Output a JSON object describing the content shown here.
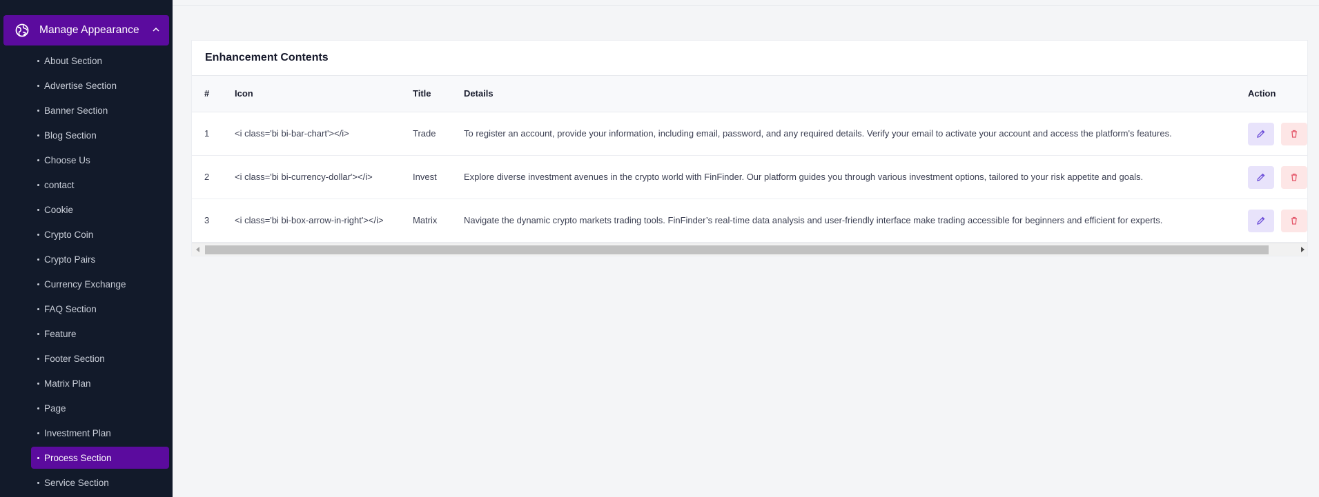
{
  "sidebar": {
    "group": {
      "label": "Manage Appearance",
      "icon": "globe-icon",
      "expanded": true
    },
    "items": [
      {
        "label": "About Section"
      },
      {
        "label": "Advertise Section"
      },
      {
        "label": "Banner Section"
      },
      {
        "label": "Blog Section"
      },
      {
        "label": "Choose Us"
      },
      {
        "label": "contact"
      },
      {
        "label": "Cookie"
      },
      {
        "label": "Crypto Coin"
      },
      {
        "label": "Crypto Pairs"
      },
      {
        "label": "Currency Exchange"
      },
      {
        "label": "FAQ Section"
      },
      {
        "label": "Feature"
      },
      {
        "label": "Footer Section"
      },
      {
        "label": "Matrix Plan"
      },
      {
        "label": "Page"
      },
      {
        "label": "Investment Plan"
      },
      {
        "label": "Process Section",
        "active": true
      },
      {
        "label": "Service Section"
      }
    ]
  },
  "card": {
    "title": "Enhancement Contents"
  },
  "table": {
    "headers": {
      "num": "#",
      "icon": "Icon",
      "title": "Title",
      "details": "Details",
      "action": "Action"
    },
    "rows": [
      {
        "num": "1",
        "icon": "<i class='bi bi-bar-chart'></i>",
        "title": "Trade",
        "details": "To register an account, provide your information, including email, password, and any required details. Verify your email to activate your account and access the platform's features."
      },
      {
        "num": "2",
        "icon": "<i class='bi bi-currency-dollar'></i>",
        "title": "Invest",
        "details": "Explore diverse investment avenues in the crypto world with FinFinder. Our platform guides you through various investment options, tailored to your risk appetite and goals."
      },
      {
        "num": "3",
        "icon": "<i class='bi bi-box-arrow-in-right'></i>",
        "title": "Matrix",
        "details": "Navigate the dynamic crypto markets trading tools. FinFinder’s real-time data analysis and user-friendly interface make trading accessible for beginners and efficient for experts."
      }
    ]
  },
  "colors": {
    "sidebar_bg": "#121a2a",
    "accent": "#5b0b9e",
    "edit_btn": "#e8e3fb",
    "delete_btn": "#fde6e6"
  }
}
